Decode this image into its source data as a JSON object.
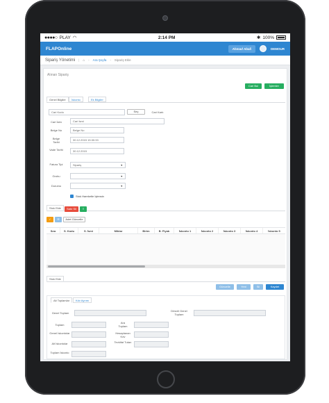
{
  "status": {
    "carrier": "PLAY",
    "time": "2:14 PM",
    "battery": "100%"
  },
  "app": {
    "brand": "FLAPOnline",
    "pill": "Ahmad Abali",
    "user": "DEMOUR"
  },
  "breadcrumb": {
    "title": "Sipariş Yönetimi",
    "items": [
      "Ara Şoyfa",
      "Sipariş Ekle"
    ]
  },
  "form": {
    "section_title": "Alınan Sipariş",
    "btn_cari": "Cari Bul",
    "btn_islemler": "İşlemler",
    "tabs": [
      "Genel Bilgiler",
      "İskonto",
      "Ek Bilgiler"
    ],
    "cari_kodu_placeholder": "Cari Kodu",
    "sec_btn": "Seç",
    "cari_kartı": "Cari Kartı",
    "labels": {
      "cari_isim": "Cari İsim",
      "belge_no": "Belge No",
      "belge_tarihi": "Belge Tarihi",
      "vade_tarihi": "Vade Tarihi",
      "fatura_tipi": "Fatura Tipi",
      "grubu": "Grubu",
      "durumu": "Durumu"
    },
    "values": {
      "cari_isim": "Cari İsmi",
      "belge_no": "Belge No",
      "belge_tarihi": "30.12.2015 15:30:33",
      "vade_tarihi": "30.12.2015",
      "fatura_tipi": "Sipariş"
    },
    "stock_check": "Stok Hareketle İşlensin"
  },
  "grid": {
    "tab_stok": "Stok Ekle",
    "btn_red": "Satır Sil",
    "btn_green": "≡",
    "btn_orange": "✓",
    "btn_blue": "☰",
    "btn_adet": "Adet Güncelle",
    "columns": [
      "Sıra",
      "S. Kodu",
      "S. İsmi",
      "Miktar",
      "Birim",
      "B. Fiyatı",
      "İskonto 1",
      "İskonto 2",
      "İskonto 3",
      "İskonto 4",
      "İskonto 5"
    ],
    "bottom_tab": "Stok Ekle"
  },
  "actions": [
    "Güncelle",
    "Yeni",
    "Sil",
    "Kaydet"
  ],
  "totals": {
    "tabs": [
      "Alt Toplamlar",
      "Kdv Ayrımı"
    ],
    "labels": {
      "genel": "Genel Toplam",
      "dovizli": "Dövizli Genel Toplam",
      "toplam": "Toplam",
      "ara": "Ara Toplam",
      "genel_iskonto": "Genel İskontolar",
      "hesaplanan": "Hesaplanan Kdv",
      "alt_iskonto": "Alt İskontolar",
      "tevkifat": "Tevkifat Tutarı",
      "toplam_iskonto": "Toplam İskonto"
    }
  },
  "colors": {
    "accent": "#2e86d1",
    "green": "#27ae60",
    "red": "#e74c3c",
    "orange": "#f39c12"
  }
}
